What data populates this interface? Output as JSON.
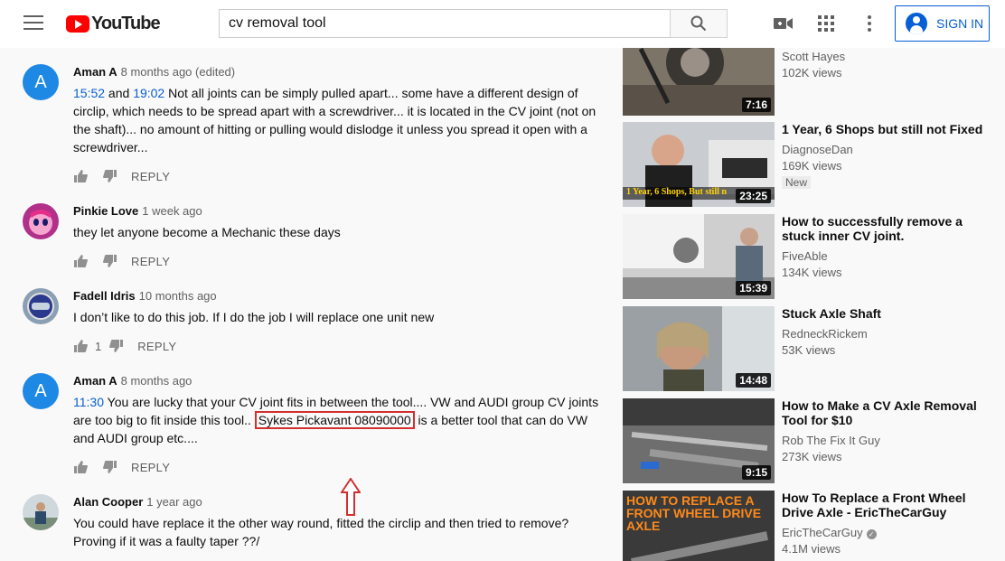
{
  "header": {
    "logo_text": "YouTube",
    "search_value": "cv removal tool",
    "signin_label": "SIGN IN",
    "brand_color": "#ff0000",
    "accent_color": "#065fd4"
  },
  "comments": [
    {
      "avatar_letter": "A",
      "author": "Aman A",
      "time": "8 months ago (edited)",
      "ts1": "15:52",
      "and": " and ",
      "ts2": "19:02",
      "text": "  Not all joints can be simply pulled apart... some have a different design of circlip, which needs to be spread apart with a screwdriver... it is located in the CV joint (not on the shaft)... no amount of hitting or pulling would dislodge it unless you spread it open with a screwdriver...",
      "likes": "",
      "reply": "REPLY"
    },
    {
      "author": "Pinkie Love",
      "time": "1 week ago",
      "text": "they let anyone become a Mechanic these days",
      "likes": "",
      "reply": "REPLY"
    },
    {
      "author": "Fadell Idris",
      "time": "10 months ago",
      "text": "I don’t like to do this job. If I do the job I will replace one unit new",
      "likes": "1",
      "reply": "REPLY"
    },
    {
      "avatar_letter": "A",
      "author": "Aman A",
      "time": "8 months ago",
      "ts1": "11:30",
      "text_a": "  You are lucky that your CV joint fits in between the tool.... VW and AUDI group CV joints are too big to fit inside this tool..",
      "highlight": "Sykes Pickavant 08090000",
      "text_b": " is a better tool that can do VW and AUDI group etc....",
      "likes": "",
      "reply": "REPLY"
    },
    {
      "author": "Alan Cooper",
      "time": "1 year ago",
      "text": "You could have replace it the other way round, fitted the circlip and then tried to remove? Proving if it was a faulty taper ??/"
    }
  ],
  "sidebar": [
    {
      "title": "",
      "channel": "Scott Hayes",
      "views": "102K views",
      "duration": "7:16"
    },
    {
      "title": "1 Year, 6 Shops but still not Fixed",
      "channel": "DiagnoseDan",
      "views": "169K views",
      "duration": "23:25",
      "badge": "New",
      "thumb_caption": "1 Year, 6 Shops, But still n"
    },
    {
      "title": "How to successfully remove a stuck inner CV joint.",
      "channel": "FiveAble",
      "views": "134K views",
      "duration": "15:39"
    },
    {
      "title": "Stuck Axle Shaft",
      "channel": "RedneckRickem",
      "views": "53K views",
      "duration": "14:48"
    },
    {
      "title": "How to Make a CV Axle Removal Tool for $10",
      "channel": "Rob The Fix It Guy",
      "views": "273K views",
      "duration": "9:15"
    },
    {
      "title": "How To Replace a Front Wheel Drive Axle - EricTheCarGuy",
      "channel": "EricTheCarGuy",
      "views": "4.1M views",
      "duration": "",
      "thumb_caption": "HOW TO REPLACE A FRONT WHEEL DRIVE AXLE"
    }
  ]
}
